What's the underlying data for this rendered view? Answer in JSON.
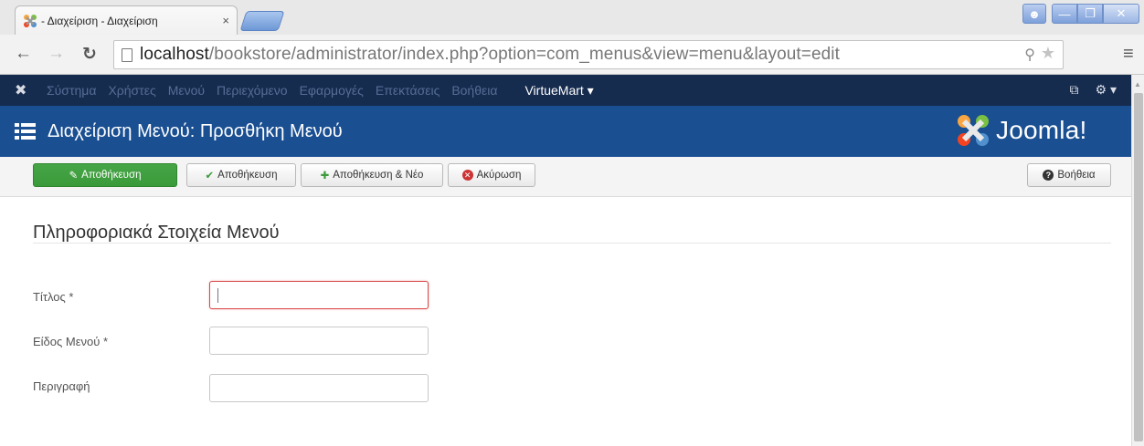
{
  "browser": {
    "tab_title": "- Διαχείριση - Διαχείριση",
    "tab_close": "×",
    "url_host": "localhost",
    "url_path": "/bookstore/administrator/index.php?option=com_menus&view=menu&layout=edit"
  },
  "topnav": {
    "items": [
      "Σύστημα",
      "Χρήστες",
      "Μενού",
      "Περιεχόμενο",
      "Εφαρμογές",
      "Επεκτάσεις",
      "Βοήθεια"
    ],
    "virtuemart": "VirtueMart"
  },
  "header": {
    "title": "Διαχείριση Μενού: Προσθήκη Μενού",
    "brand": "Joomla!"
  },
  "toolbar": {
    "save_primary": "Αποθήκευση",
    "save": "Αποθήκευση",
    "save_new": "Αποθήκευση & Νέο",
    "cancel": "Ακύρωση",
    "help": "Βοήθεια"
  },
  "form": {
    "section_title": "Πληροφοριακά Στοιχεία Μενού",
    "title_label": "Τίτλος *",
    "title_value": "",
    "type_label": "Είδος Μενού *",
    "type_value": "",
    "description_label": "Περιγραφή",
    "description_value": ""
  },
  "colors": {
    "topnav_bg": "#162c4f",
    "header_bg": "#1a4f92",
    "primary_green": "#46a546",
    "error_border": "#d94a4a"
  }
}
